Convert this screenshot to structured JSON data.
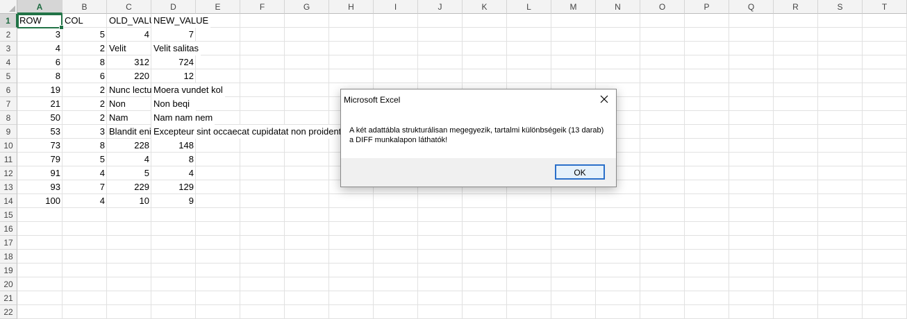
{
  "columns": [
    "A",
    "B",
    "C",
    "D",
    "E",
    "F",
    "G",
    "H",
    "I",
    "J",
    "K",
    "L",
    "M",
    "N",
    "O",
    "P",
    "Q",
    "R",
    "S",
    "T"
  ],
  "rows": [
    "1",
    "2",
    "3",
    "4",
    "5",
    "6",
    "7",
    "8",
    "9",
    "10",
    "11",
    "12",
    "13",
    "14",
    "15",
    "16",
    "17",
    "18",
    "19",
    "20",
    "21",
    "22"
  ],
  "cells": [
    {
      "row": 1,
      "col": 0,
      "v": "ROW",
      "type": "text"
    },
    {
      "row": 1,
      "col": 1,
      "v": "COL",
      "type": "text"
    },
    {
      "row": 1,
      "col": 2,
      "v": "OLD_VALUE",
      "type": "text"
    },
    {
      "row": 1,
      "col": 3,
      "v": "NEW_VALUE",
      "type": "text"
    },
    {
      "row": 2,
      "col": 0,
      "v": "3",
      "type": "num"
    },
    {
      "row": 2,
      "col": 1,
      "v": "5",
      "type": "num"
    },
    {
      "row": 2,
      "col": 2,
      "v": "4",
      "type": "num"
    },
    {
      "row": 2,
      "col": 3,
      "v": "7",
      "type": "num"
    },
    {
      "row": 3,
      "col": 0,
      "v": "4",
      "type": "num"
    },
    {
      "row": 3,
      "col": 1,
      "v": "2",
      "type": "num"
    },
    {
      "row": 3,
      "col": 2,
      "v": "Velit",
      "type": "text"
    },
    {
      "row": 3,
      "col": 3,
      "v": "Velit salitas",
      "type": "text"
    },
    {
      "row": 4,
      "col": 0,
      "v": "6",
      "type": "num"
    },
    {
      "row": 4,
      "col": 1,
      "v": "8",
      "type": "num"
    },
    {
      "row": 4,
      "col": 2,
      "v": "312",
      "type": "num"
    },
    {
      "row": 4,
      "col": 3,
      "v": "724",
      "type": "num"
    },
    {
      "row": 5,
      "col": 0,
      "v": "8",
      "type": "num"
    },
    {
      "row": 5,
      "col": 1,
      "v": "6",
      "type": "num"
    },
    {
      "row": 5,
      "col": 2,
      "v": "220",
      "type": "num"
    },
    {
      "row": 5,
      "col": 3,
      "v": "12",
      "type": "num"
    },
    {
      "row": 6,
      "col": 0,
      "v": "19",
      "type": "num"
    },
    {
      "row": 6,
      "col": 1,
      "v": "2",
      "type": "num"
    },
    {
      "row": 6,
      "col": 2,
      "v": "Nunc lectus",
      "type": "text"
    },
    {
      "row": 6,
      "col": 3,
      "v": "Moera vundet kol",
      "type": "text"
    },
    {
      "row": 7,
      "col": 0,
      "v": "21",
      "type": "num"
    },
    {
      "row": 7,
      "col": 1,
      "v": "2",
      "type": "num"
    },
    {
      "row": 7,
      "col": 2,
      "v": "Non",
      "type": "text"
    },
    {
      "row": 7,
      "col": 3,
      "v": "Non beqi",
      "type": "text"
    },
    {
      "row": 8,
      "col": 0,
      "v": "50",
      "type": "num"
    },
    {
      "row": 8,
      "col": 1,
      "v": "2",
      "type": "num"
    },
    {
      "row": 8,
      "col": 2,
      "v": "Nam",
      "type": "text"
    },
    {
      "row": 8,
      "col": 3,
      "v": "Nam nam nem",
      "type": "text"
    },
    {
      "row": 9,
      "col": 0,
      "v": "53",
      "type": "num"
    },
    {
      "row": 9,
      "col": 1,
      "v": "3",
      "type": "num"
    },
    {
      "row": 9,
      "col": 2,
      "v": "Blandit enim",
      "type": "text"
    },
    {
      "row": 9,
      "col": 3,
      "v": "Excepteur sint occaecat cupidatat non proident",
      "type": "text"
    },
    {
      "row": 10,
      "col": 0,
      "v": "73",
      "type": "num"
    },
    {
      "row": 10,
      "col": 1,
      "v": "8",
      "type": "num"
    },
    {
      "row": 10,
      "col": 2,
      "v": "228",
      "type": "num"
    },
    {
      "row": 10,
      "col": 3,
      "v": "148",
      "type": "num"
    },
    {
      "row": 11,
      "col": 0,
      "v": "79",
      "type": "num"
    },
    {
      "row": 11,
      "col": 1,
      "v": "5",
      "type": "num"
    },
    {
      "row": 11,
      "col": 2,
      "v": "4",
      "type": "num"
    },
    {
      "row": 11,
      "col": 3,
      "v": "8",
      "type": "num"
    },
    {
      "row": 12,
      "col": 0,
      "v": "91",
      "type": "num"
    },
    {
      "row": 12,
      "col": 1,
      "v": "4",
      "type": "num"
    },
    {
      "row": 12,
      "col": 2,
      "v": "5",
      "type": "num"
    },
    {
      "row": 12,
      "col": 3,
      "v": "4",
      "type": "num"
    },
    {
      "row": 13,
      "col": 0,
      "v": "93",
      "type": "num"
    },
    {
      "row": 13,
      "col": 1,
      "v": "7",
      "type": "num"
    },
    {
      "row": 13,
      "col": 2,
      "v": "229",
      "type": "num"
    },
    {
      "row": 13,
      "col": 3,
      "v": "129",
      "type": "num"
    },
    {
      "row": 14,
      "col": 0,
      "v": "100",
      "type": "num"
    },
    {
      "row": 14,
      "col": 1,
      "v": "4",
      "type": "num"
    },
    {
      "row": 14,
      "col": 2,
      "v": "10",
      "type": "num"
    },
    {
      "row": 14,
      "col": 3,
      "v": "9",
      "type": "num"
    }
  ],
  "selection": {
    "cell": "A1"
  },
  "colors": {
    "accent": "#217346",
    "dialog_button_border": "#2a6fc9"
  },
  "dialog": {
    "title": "Microsoft Excel",
    "message": "A két adattábla strukturálisan megegyezik, tartalmi különbségeik (13 darab) a DIFF munkalapon láthatók!",
    "ok_label": "OK",
    "close_icon": "close-icon"
  }
}
